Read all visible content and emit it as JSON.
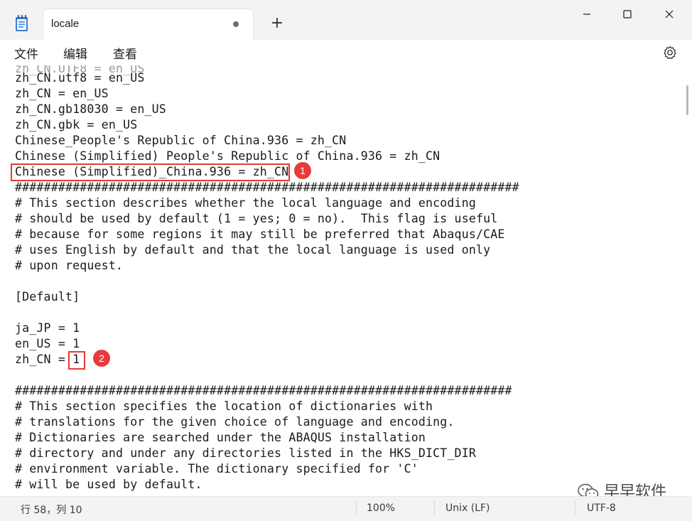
{
  "window": {
    "tab_title": "locale",
    "new_tab_symbol": "+"
  },
  "menu": {
    "file": "文件",
    "edit": "编辑",
    "view": "查看"
  },
  "editor": {
    "lines": [
      "zh_CN.utf8 = en_US",
      "zh_CN = en_US",
      "zh_CN.gb18030 = en_US",
      "zh_CN.gbk = en_US",
      "Chinese_People's Republic of China.936 = zh_CN",
      "Chinese (Simplified) People's Republic of China.936 = zh_CN",
      "Chinese (Simplified)_China.936 = zh_CN",
      "######################################################################",
      "# This section describes whether the local language and encoding",
      "# should be used by default (1 = yes; 0 = no).  This flag is useful",
      "# because for some regions it may still be preferred that Abaqus/CAE",
      "# uses English by default and that the local language is used only",
      "# upon request.",
      "",
      "[Default]",
      "",
      "ja_JP = 1",
      "en_US = 1",
      "zh_CN = 1",
      "",
      "#####################################################################",
      "# This section specifies the location of dictionaries with",
      "# translations for the given choice of language and encoding.",
      "# Dictionaries are searched under the ABAQUS installation",
      "# directory and under any directories listed in the HKS_DICT_DIR",
      "# environment variable. The dictionary specified for 'C'",
      "# will be used by default."
    ]
  },
  "annotations": [
    {
      "label": "1"
    },
    {
      "label": "2"
    }
  ],
  "status": {
    "position": "行 58，列 10",
    "zoom": "100%",
    "line_ending": "Unix (LF)",
    "encoding": "UTF-8"
  },
  "watermark": {
    "text": "早早软件"
  },
  "colors": {
    "annotation_red": "#e23a3a",
    "titlebar_bg": "#f3f3f3"
  },
  "icons": {
    "app": "notepad-icon",
    "settings": "gear-icon",
    "minimize": "minimize-icon",
    "maximize": "maximize-icon",
    "close": "close-icon",
    "watermark": "wechat-icon"
  }
}
